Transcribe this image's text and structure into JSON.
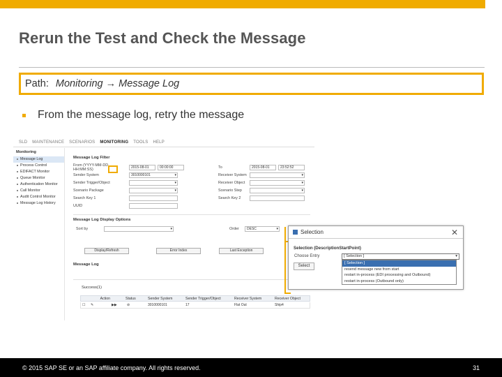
{
  "slide": {
    "title": "Rerun the Test and Check the Message",
    "path_lead": "Path:",
    "path_value": "Monitoring → Message Log",
    "bullet": "From the message log, retry the message",
    "footer_copyright": "© 2015 SAP SE or an SAP affiliate company. All rights reserved.",
    "page_number": "31",
    "accent_color": "#f0ab00"
  },
  "sap": {
    "nav_tabs": [
      "SLD",
      "MAINTENANCE",
      "SCENARIOS",
      "MONITORING",
      "TOOLS",
      "HELP"
    ],
    "active_tab": "MONITORING",
    "sidebar_head": "Monitoring",
    "sidebar_items": [
      "Message Log",
      "Process Control",
      "EDIFACT Monitor",
      "Queue Monitor",
      "Authentication Monitor",
      "Call Monitor",
      "Audit Control Monitor",
      "Message Log History"
    ],
    "filter_title": "Message Log Filter",
    "filter_left": [
      {
        "label": "From (YYYY-MM-DD HH:MM:SS)",
        "value": "2015-08-01",
        "value2": "00:00:00"
      },
      {
        "label": "Sender System",
        "value": "3010000101"
      },
      {
        "label": "Sender Trigger/Object",
        "value": ""
      },
      {
        "label": "Scenario Package",
        "value": ""
      },
      {
        "label": "Search Key 1",
        "value": ""
      },
      {
        "label": "UUID",
        "value": ""
      }
    ],
    "filter_right": [
      {
        "label": "To",
        "value": "2015-08-01",
        "value2": "23:52:52"
      },
      {
        "label": "Receiver System",
        "value": ""
      },
      {
        "label": "Receiver Object",
        "value": ""
      },
      {
        "label": "Scenario Step",
        "value": ""
      },
      {
        "label": "Search Key 2",
        "value": ""
      }
    ],
    "display_title": "Message Log Display Options",
    "sort_label": "Sort by",
    "order_label": "Order",
    "order_value": "DESC",
    "buttons": [
      "Display/Refresh",
      "Error Index",
      "Last Exception"
    ],
    "log_title": "Message Log",
    "success_label": "Success(1)",
    "columns": [
      "Action",
      "Status",
      "Sender System",
      "Sender Trigger/Object",
      "Receiver System",
      "Receiver Object"
    ],
    "row": [
      "",
      "",
      "3010000101",
      "17",
      "Flat Out",
      "Ship4"
    ]
  },
  "dialog": {
    "title": "Selection",
    "close": "✕",
    "subtitle": "Selection (DescriptionStartPoint)",
    "choose_label": "Choose Entry",
    "selected_value": "[ Selection ]",
    "select_button": "Select",
    "options": [
      "[ Selection ]",
      "resend message new from start",
      "restart in-process (EDI processing and Outbound)",
      "restart in-process (Outbound only)"
    ]
  }
}
